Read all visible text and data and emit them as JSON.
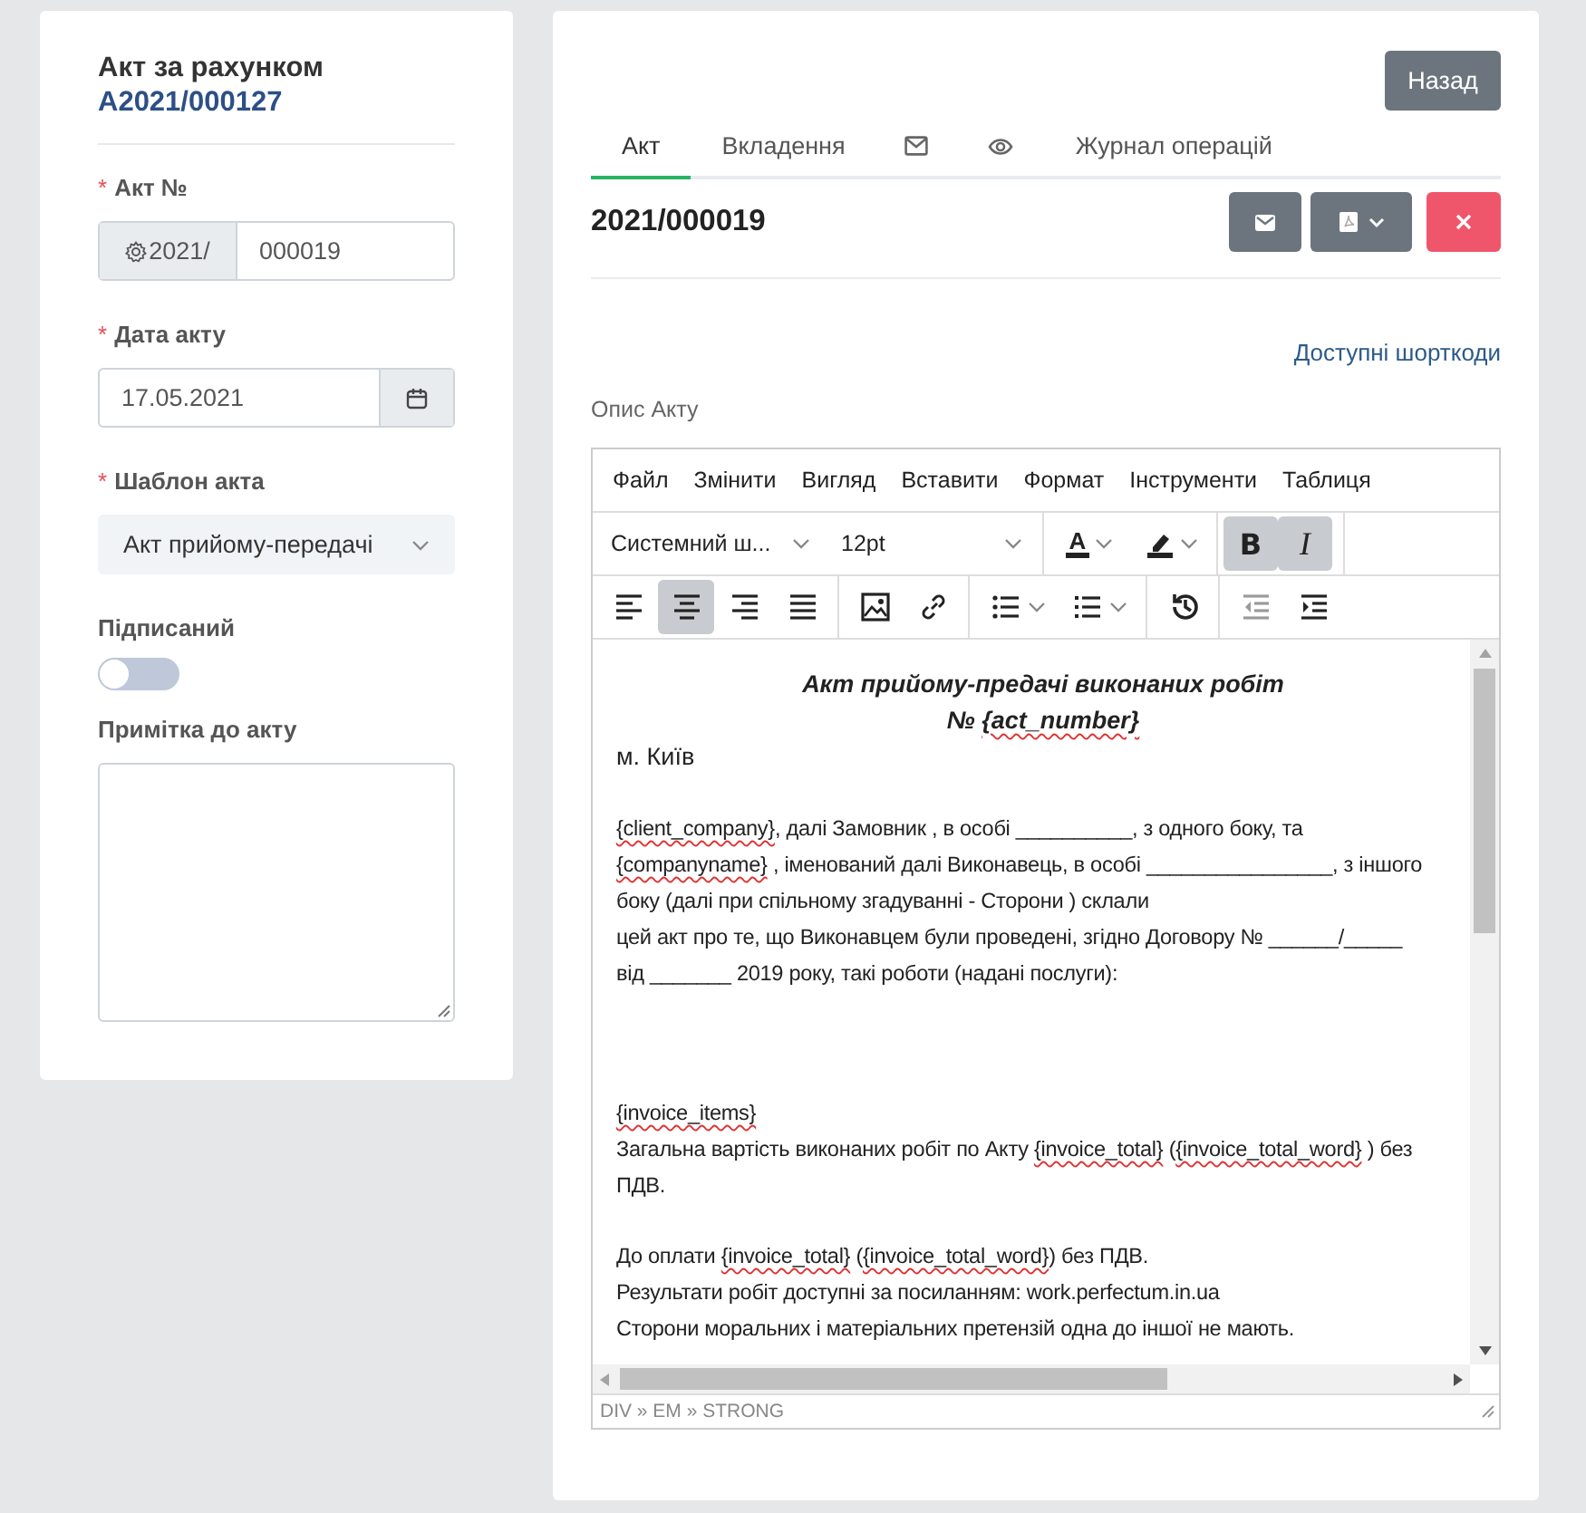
{
  "sidebar": {
    "title": "Акт за рахунком",
    "invoice_number": "A2021/000127",
    "fields": [
      {
        "kind": "prefixed",
        "label": "Акт №",
        "required_mark": "*",
        "prefix": "2021/",
        "value": "000019"
      },
      {
        "kind": "date",
        "label": "Дата акту",
        "required_mark": "*",
        "value": "17.05.2021"
      },
      {
        "kind": "select",
        "label": "Шаблон акта",
        "required_mark": "*",
        "value": "Акт прийому-передачі"
      },
      {
        "kind": "toggle",
        "label": "Підписаний",
        "on": false
      },
      {
        "kind": "textarea",
        "label": "Примітка до акту"
      }
    ]
  },
  "back_button": "Назад",
  "tabs": [
    {
      "kind": "text",
      "label": "Акт",
      "selected": true
    },
    {
      "kind": "text",
      "label": "Вкладення",
      "selected": false
    },
    {
      "kind": "mail",
      "selected": false
    },
    {
      "kind": "eye",
      "selected": false
    },
    {
      "kind": "text",
      "label": "Журнал операцій",
      "selected": false
    }
  ],
  "act_number": "2021/000019",
  "actions": [
    {
      "kind": "email"
    },
    {
      "kind": "pdf"
    },
    {
      "kind": "delete"
    }
  ],
  "shortcodes_link": "Доступні шорткоди",
  "description_label": "Опис Акту",
  "editor": {
    "menu": [
      "Файл",
      "Змінити",
      "Вигляд",
      "Вставити",
      "Формат",
      "Інструменти",
      "Таблиця"
    ],
    "font": "Системний ш...",
    "size": "12pt",
    "color_tools": [
      {
        "kind": "text-color",
        "label": "A"
      },
      {
        "kind": "highlight"
      }
    ],
    "format_buttons": [
      {
        "label": "B",
        "kind": "bold",
        "pressed": true
      },
      {
        "label": "I",
        "kind": "italic",
        "pressed": true
      }
    ],
    "tool_groups": [
      [
        {
          "kind": "align-left",
          "pressed": false,
          "disabled": false
        },
        {
          "kind": "align-center",
          "pressed": true,
          "disabled": false
        },
        {
          "kind": "align-right",
          "pressed": false,
          "disabled": false
        },
        {
          "kind": "justify",
          "pressed": false,
          "disabled": false
        }
      ],
      [
        {
          "kind": "image",
          "pressed": false,
          "disabled": false
        },
        {
          "kind": "link",
          "pressed": false,
          "disabled": false
        }
      ],
      [
        {
          "kind": "bullet-list",
          "pressed": false,
          "disabled": false
        },
        {
          "kind": "numbered-list",
          "pressed": false,
          "disabled": false
        }
      ],
      [
        {
          "kind": "history",
          "pressed": false,
          "disabled": false
        }
      ],
      [
        {
          "kind": "outdent",
          "pressed": false,
          "disabled": true
        },
        {
          "kind": "indent",
          "pressed": false,
          "disabled": false
        }
      ]
    ],
    "content": [
      {
        "kind": "title",
        "parts": [
          {
            "text": "Акт прийому-предачі виконаних робіт",
            "misspelled": false
          }
        ]
      },
      {
        "kind": "title",
        "parts": [
          {
            "text": "№ ",
            "misspelled": false
          },
          {
            "text": "{act_number}",
            "misspelled": true
          }
        ]
      },
      {
        "kind": "city",
        "parts": [
          {
            "text": "м. Київ",
            "misspelled": false
          }
        ]
      },
      {
        "kind": "blank"
      },
      {
        "kind": "text",
        "parts": [
          {
            "text": "{client_company}",
            "misspelled": true
          },
          {
            "text": ", далі Замовник , в особі __________, з одного боку, та",
            "misspelled": false
          }
        ]
      },
      {
        "kind": "text",
        "parts": [
          {
            "text": "{companyname}",
            "misspelled": true
          },
          {
            "text": " , іменований далі Виконавець, в особі ________________, з іншого",
            "misspelled": false
          }
        ]
      },
      {
        "kind": "text",
        "parts": [
          {
            "text": "боку (далі при спільному згадуванні - Сторони ) склали",
            "misspelled": false
          }
        ]
      },
      {
        "kind": "text",
        "parts": [
          {
            "text": "цей акт про те, що Виконавцем були проведені, згідно Договору № ______/_____",
            "misspelled": false
          }
        ]
      },
      {
        "kind": "text",
        "parts": [
          {
            "text": "від _______ 2019 року, такі роботи (надані послуги):",
            "misspelled": false
          }
        ]
      },
      {
        "kind": "blank"
      },
      {
        "kind": "blank"
      },
      {
        "kind": "blank"
      },
      {
        "kind": "text",
        "parts": [
          {
            "text": "{invoice_items}",
            "misspelled": true
          }
        ]
      },
      {
        "kind": "text",
        "parts": [
          {
            "text": "Загальна вартість виконаних робіт по Акту ",
            "misspelled": false
          },
          {
            "text": "{invoice_total}",
            "misspelled": true
          },
          {
            "text": " (",
            "misspelled": false
          },
          {
            "text": "{invoice_total_word}",
            "misspelled": true
          },
          {
            "text": " ) без",
            "misspelled": false
          }
        ]
      },
      {
        "kind": "text",
        "parts": [
          {
            "text": "ПДВ.",
            "misspelled": false
          }
        ]
      },
      {
        "kind": "blank"
      },
      {
        "kind": "text",
        "parts": [
          {
            "text": "До оплати ",
            "misspelled": false
          },
          {
            "text": "{invoice_total}",
            "misspelled": true
          },
          {
            "text": " (",
            "misspelled": false
          },
          {
            "text": "{invoice_total_word}",
            "misspelled": true
          },
          {
            "text": ") без ПДВ.",
            "misspelled": false
          }
        ]
      },
      {
        "kind": "text",
        "parts": [
          {
            "text": "Результати робіт доступні за посиланням: work.perfectum.in.ua",
            "misspelled": false
          }
        ]
      },
      {
        "kind": "text",
        "parts": [
          {
            "text": "Сторони моральних і матеріальних претензій одна до іншої не мають.",
            "misspelled": false
          }
        ]
      }
    ],
    "path": "DIV » EM » STRONG"
  }
}
